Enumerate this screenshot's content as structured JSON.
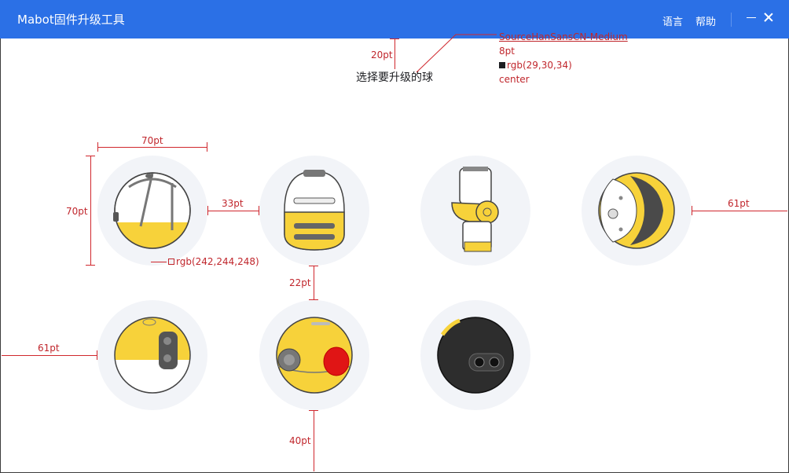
{
  "window": {
    "title": "Mabot固件升级工具",
    "menu": {
      "language": "语言",
      "help": "帮助"
    },
    "colors": {
      "titlebar": "#2b70e6"
    }
  },
  "main": {
    "heading": "选择要升级的球",
    "balls": [
      {
        "name": "ball-1",
        "icon": "ball-shell-white-yellow-icon"
      },
      {
        "name": "ball-2",
        "icon": "ball-drive-white-yellow-icon"
      },
      {
        "name": "ball-3",
        "icon": "ball-joint-white-yellow-icon"
      },
      {
        "name": "ball-4",
        "icon": "ball-wheel-grey-yellow-icon"
      },
      {
        "name": "ball-5",
        "icon": "ball-sensor-yellow-white-icon"
      },
      {
        "name": "ball-6",
        "icon": "ball-button-yellow-red-icon"
      },
      {
        "name": "ball-7",
        "icon": "ball-camera-black-icon"
      }
    ],
    "circle_color": "#f2f4f8"
  },
  "annotations": {
    "font_name": "SourceHanSansCN-Medium",
    "font_size": "8pt",
    "font_color": "rgb(29,30,34)",
    "font_color_hex": "#1d1e22",
    "align": "center",
    "top_gap": "20pt",
    "ball_width": "70pt",
    "ball_height": "70pt",
    "h_gap": "33pt",
    "v_gap": "22pt",
    "right_margin": "61pt",
    "left_margin": "61pt",
    "bottom_margin": "40pt",
    "circle_color": "rgb(242,244,248)",
    "circle_color_hex": "#f2f4f8",
    "color": "#c0262c"
  }
}
